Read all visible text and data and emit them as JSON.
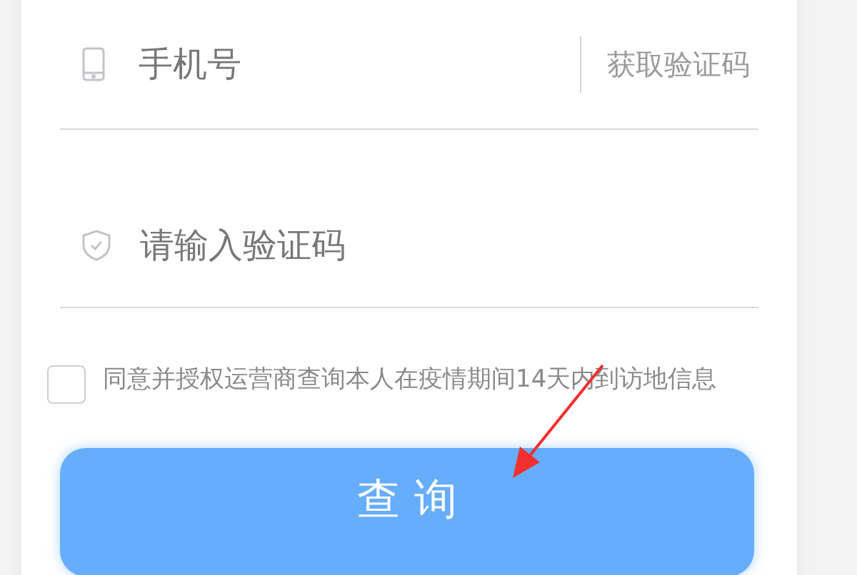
{
  "phone_field": {
    "placeholder": "手机号"
  },
  "get_code_button": {
    "label": "获取验证码"
  },
  "code_field": {
    "placeholder": "请输入验证码"
  },
  "consent": {
    "checked": false,
    "text": "同意并授权运营商查询本人在疫情期间14天内到访地信息"
  },
  "submit_button": {
    "label": "查 询"
  }
}
